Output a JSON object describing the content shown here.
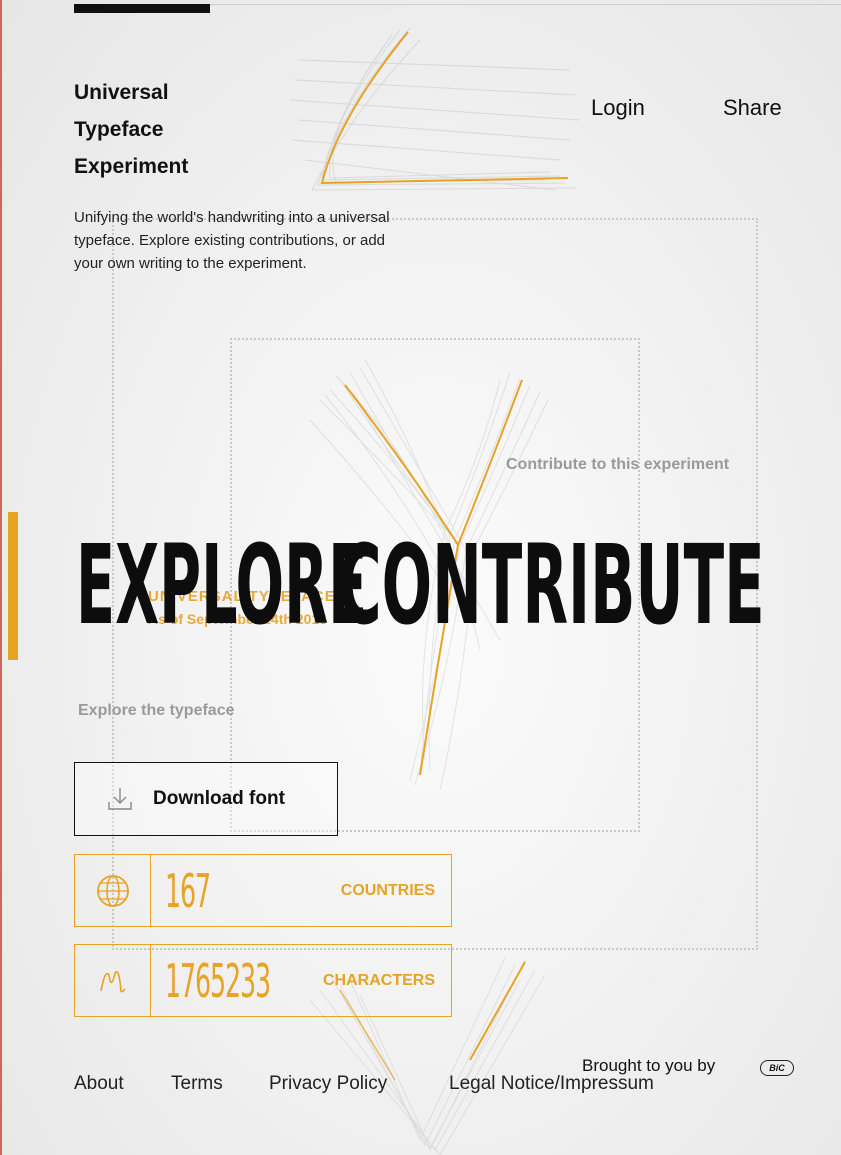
{
  "brand": {
    "line1": "Universal",
    "line2": "Typeface",
    "line3": "Experiment"
  },
  "nav": {
    "login": "Login",
    "share": "Share"
  },
  "intro": "Unifying the world's handwriting into a universal typeface. Explore existing contributions, or add your own writing to the experiment.",
  "hero": {
    "explore": "EXPLORE",
    "contribute": "CONTRIBUTE",
    "contribute_hint": "Contribute to this experiment",
    "explore_hint": "Explore the typeface",
    "overlay_line1": "UNIVERSAL TYPEFACE",
    "overlay_line2": "As of September 14th 2016"
  },
  "download": {
    "label": "Download font",
    "icon": "download-icon"
  },
  "stats": [
    {
      "value": "167",
      "caption": "COUNTRIES",
      "icon": "globe-icon"
    },
    {
      "value": "1765233",
      "caption": "CHARACTERS",
      "icon": "handwriting-icon"
    }
  ],
  "footer": {
    "links": [
      "About",
      "Terms",
      "Privacy Policy",
      "Legal Notice/Impressum"
    ],
    "brought_by": "Brought to you by",
    "sponsor": "BiC"
  },
  "colors": {
    "accent": "#e8a224",
    "text": "#111111",
    "hint": "#9a9a9a"
  }
}
